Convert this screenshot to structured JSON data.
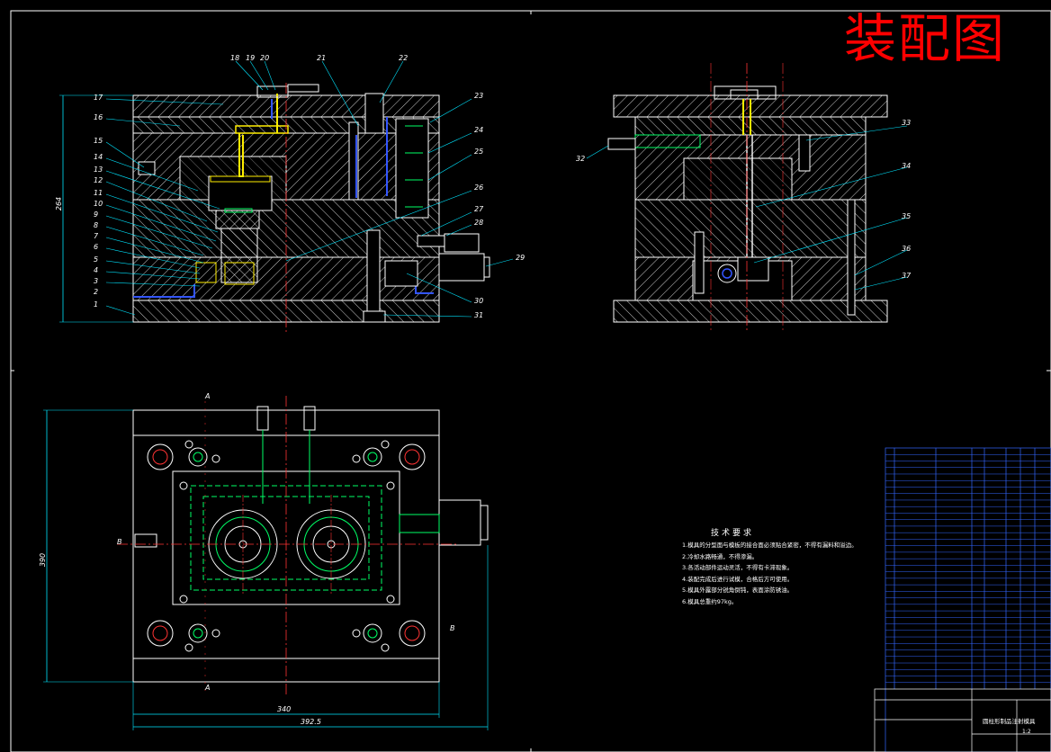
{
  "title": "装配图",
  "colors": {
    "background": "#000000",
    "outline": "#ffffff",
    "hatch": "#ffffff",
    "centerline": "#ff3333",
    "dimension": "#00e5ff",
    "leader": "#00e5ff",
    "cooling": "#00ff66",
    "part_yellow": "#ffee00",
    "part_blue": "#3355ff",
    "title_red": "#ff0000",
    "table_line": "#3366ff"
  },
  "balloons_main": [
    "18",
    "19",
    "20",
    "21",
    "22",
    "23",
    "24",
    "25",
    "26",
    "27",
    "28",
    "29",
    "30",
    "31"
  ],
  "balloons_left": [
    "17",
    "16",
    "15",
    "14",
    "13",
    "12",
    "11",
    "10",
    "9",
    "8",
    "7",
    "6",
    "5",
    "4",
    "3",
    "2",
    "1"
  ],
  "balloons_side": [
    "32",
    "33",
    "34",
    "35",
    "36",
    "37"
  ],
  "dims": {
    "height_main": "264",
    "height_plan": "390",
    "width_inner": "340",
    "width_outer": "392.5"
  },
  "section_marks": {
    "a": "A",
    "b": "B"
  },
  "tech_requirements": {
    "heading": "技术要求",
    "items": [
      "1.模具的分型面与模板的接合面必须贴合紧密，不得有漏料和溢边。",
      "2.冷却水路畅通，不得渗漏。",
      "3.各活动部件运动灵活，不得有卡滞现象。",
      "4.装配完成后进行试模，合格后方可使用。",
      "5.模具外露部分锐角倒钝，表面涂防锈油。",
      "6.模具总重约97kg。"
    ]
  },
  "title_block": {
    "drawing_name": "圆柱形制品注射模具",
    "scale": "1:2"
  },
  "bom_rows": 37
}
